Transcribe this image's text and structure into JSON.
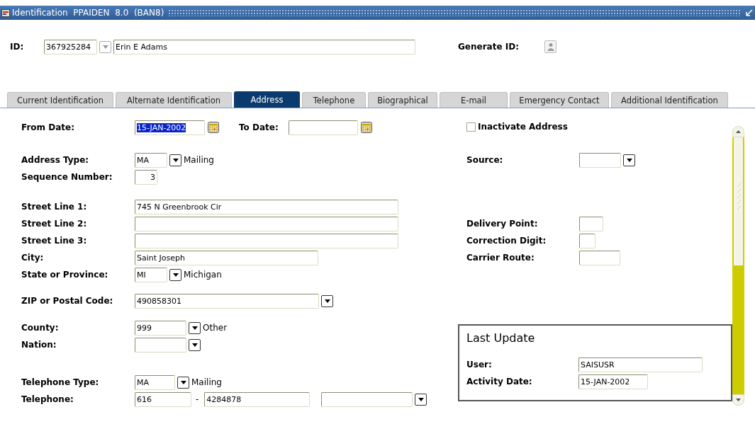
{
  "window": {
    "title": "Identification  PPAIDEN  8.0  (BAN8)"
  },
  "id_row": {
    "label": "ID:",
    "id_value": "367925284",
    "lookup_disabled": true,
    "name_value": "Erin E Adams",
    "generate_label": "Generate ID:"
  },
  "tabs": [
    {
      "label": "Current Identification",
      "selected": false
    },
    {
      "label": "Alternate Identification",
      "selected": false
    },
    {
      "label": "Address",
      "selected": true
    },
    {
      "label": "Telephone",
      "selected": false
    },
    {
      "label": "Biographical",
      "selected": false
    },
    {
      "label": "E-mail",
      "selected": false
    },
    {
      "label": "Emergency Contact",
      "selected": false
    },
    {
      "label": "Additional Identification",
      "selected": false
    }
  ],
  "address_fields": [
    {
      "kind": "date-range",
      "label": "From Date:",
      "value": "15-JAN-2002",
      "selected": true,
      "to_label": "To Date:"
    },
    {
      "kind": "code",
      "label": "Address Type:",
      "value": "MA",
      "description": "Mailing"
    },
    {
      "kind": "number",
      "label": "Sequence Number:",
      "value": "3"
    },
    {
      "kind": "text",
      "label": "Street Line 1:",
      "value": "745 N Greenbrook Cir"
    },
    {
      "kind": "text",
      "label": "Street Line 2:"
    },
    {
      "kind": "text",
      "label": "Street Line 3:"
    },
    {
      "kind": "text",
      "label": "City:",
      "value": "Saint Joseph"
    },
    {
      "kind": "code",
      "label": "State or Province:",
      "value": "MI",
      "description": "Michigan"
    },
    {
      "kind": "text-dropdown",
      "label": "ZIP or Postal Code:",
      "value": "490858301"
    },
    {
      "kind": "code",
      "label": "County:",
      "value": "999",
      "description": "Other"
    },
    {
      "kind": "code",
      "label": "Nation:"
    },
    {
      "kind": "code",
      "label": "Telephone Type:",
      "value": "MA",
      "description": "Mailing"
    },
    {
      "kind": "phone",
      "label": "Telephone:",
      "area": "616",
      "separator": "-",
      "number": "4284878"
    }
  ],
  "inactivate": {
    "label": "Inactivate Address",
    "checked": false
  },
  "right_fields": [
    {
      "kind": "dropdown",
      "label": "Source:"
    },
    {
      "kind": "text",
      "label": "Delivery Point:"
    },
    {
      "kind": "text",
      "label": "Correction Digit:"
    },
    {
      "kind": "text",
      "label": "Carrier Route:"
    }
  ],
  "last_update": {
    "title": "Last Update",
    "fields": [
      {
        "label": "User:",
        "value": "SAISUSR"
      },
      {
        "label": "Activity Date:",
        "value": "15-JAN-2002"
      }
    ]
  }
}
